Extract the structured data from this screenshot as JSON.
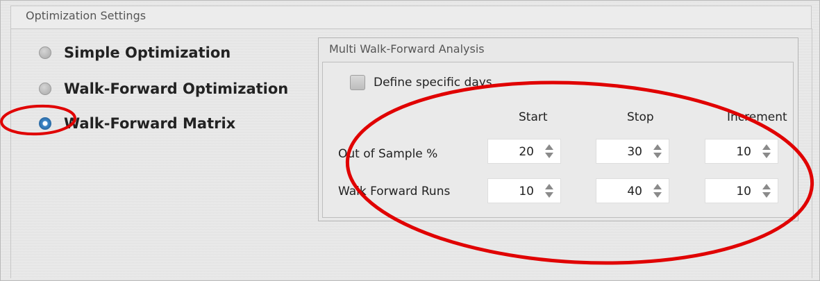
{
  "settings": {
    "title": "Optimization Settings",
    "options": [
      {
        "label": "Simple Optimization",
        "checked": false
      },
      {
        "label": "Walk-Forward Optimization",
        "checked": false
      },
      {
        "label": "Walk-Forward Matrix",
        "checked": true
      }
    ]
  },
  "mwfa": {
    "title": "Multi Walk-Forward Analysis",
    "define_days_label": "Define specific days",
    "columns": {
      "start": "Start",
      "stop": "Stop",
      "increment": "Increment"
    },
    "rows": [
      {
        "label": "Out of Sample %",
        "start": "20",
        "stop": "30",
        "increment": "10"
      },
      {
        "label": "Walk Forward Runs",
        "start": "10",
        "stop": "40",
        "increment": "10"
      }
    ]
  },
  "colors": {
    "annotation": "#e00000",
    "radio_selected": "#3f88c9"
  },
  "icons": {
    "spin": "up-down-arrows-icon"
  }
}
